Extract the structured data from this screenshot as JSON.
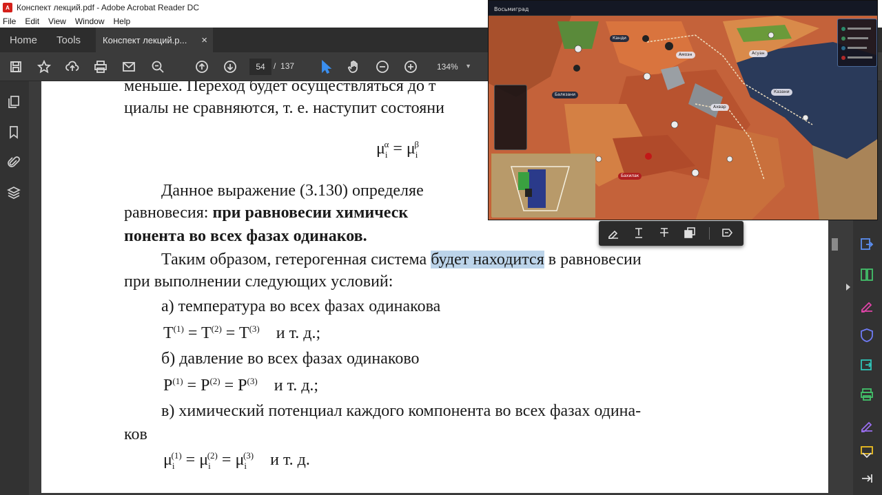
{
  "window": {
    "title": "Конспект лекций.pdf - Adobe Acrobat Reader DC"
  },
  "menu": [
    "File",
    "Edit",
    "View",
    "Window",
    "Help"
  ],
  "tabs": {
    "home": "Home",
    "tools": "Tools",
    "doc": "Конспект лекций.p...",
    "close": "×"
  },
  "toolbar": {
    "page_current": "54",
    "page_total": "137",
    "page_sep": "/",
    "zoom": "134%"
  },
  "document": {
    "line1": "меньше. Переход будет осуществляться до т",
    "line2": "циалы не сравняются, т. е. наступит состояни",
    "f1_mu1": "μ",
    "f1_sub1": "i",
    "f1_sup1": "α",
    "f1_eq": " = ",
    "f1_mu2": "μ",
    "f1_sub2": "i",
    "f1_sup2": "β",
    "line3": "Данное выражение (3.130) определяе",
    "line4_a": "равновесия: ",
    "line4_b": "при равновесии химическ",
    "line5": "понента во всех фазах одинаков.",
    "line6_a": "Таким образом, гетерогенная система ",
    "line6_hl": "будет находится",
    "line6_b": " в равновесии",
    "line7": "при выполнении следующих условий:",
    "line8": "а) температура во всех фазах одинакова",
    "t_formula": {
      "T": "T",
      "s1": "(1)",
      "s2": "(2)",
      "s3": "(3)",
      "eq": " = ",
      "tail": "и т. д.;"
    },
    "line9": "б) давление во всех фазах одинаково",
    "p_formula": {
      "P": "P",
      "s1": "(1)",
      "s2": "(2)",
      "s3": "(3)",
      "eq": " = ",
      "tail": "и т. д.;"
    },
    "line10": "в) химический потенциал каждого компонента во всех фазах одина-",
    "line11": "ков",
    "mu_formula": {
      "mu": "μ",
      "sub": "i",
      "s1": "(1)",
      "s2": "(2)",
      "s3": "(3)",
      "eq": " = ",
      "tail": "и т. д."
    }
  },
  "game": {
    "title": "Восьмиград",
    "cities": [
      "Канди",
      "Амоэн",
      "Асуан",
      "Балезани",
      "Ахвар",
      "Казани",
      "Бахилак"
    ],
    "colors": {
      "land": "#c4623a",
      "ocean": "#2a3a5a",
      "border": "#f0e0c0"
    }
  },
  "colors": {
    "accent": "#d4201a",
    "highlight": "#bcd4ea",
    "panel": "#323232",
    "bg": "#3b3b3b"
  }
}
